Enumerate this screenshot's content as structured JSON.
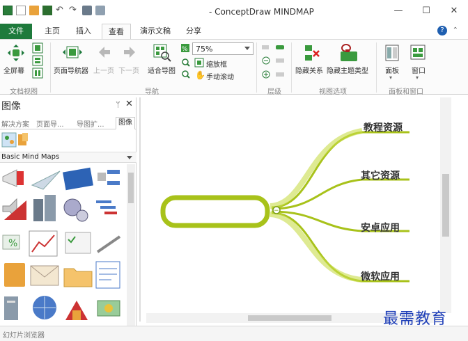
{
  "window": {
    "title": "- ConceptDraw MINDMAP",
    "controls": {
      "minimize": "—",
      "maximize": "☐",
      "close": "✕"
    }
  },
  "tabs": [
    {
      "label": "文件"
    },
    {
      "label": "主页"
    },
    {
      "label": "插入"
    },
    {
      "label": "查看"
    },
    {
      "label": "演示文稿"
    },
    {
      "label": "分享"
    }
  ],
  "active_tab": "查看",
  "help_label": "?",
  "ribbon": {
    "fullscreen": "全屏幕",
    "page_navigator": "页面导航器",
    "prev_page": "上一页",
    "next_page": "下一页",
    "fit_map": "适合导图",
    "zoom_value": "75%",
    "zoom_frame": "缩放框",
    "hand_scroll": "手动滚动",
    "hide_relations": "隐藏关系",
    "hide_topic_types": "隐藏主题类型",
    "panels": "面板",
    "window": "窗口",
    "groups": {
      "doc_view": "文档视图",
      "navigation": "导航",
      "levels": "层级",
      "view_options": "视图选项",
      "panels_windows": "面板和窗口"
    }
  },
  "left_panel": {
    "title": "图像",
    "pin": "ᛘ",
    "close": "✕",
    "tabs": [
      {
        "label": "解决方案"
      },
      {
        "label": "页面导..."
      },
      {
        "label": "导图扩..."
      },
      {
        "label": "图像"
      }
    ],
    "library": "Basic Mind Maps"
  },
  "canvas": {
    "topics": [
      {
        "label": "教程资源"
      },
      {
        "label": "其它资源"
      },
      {
        "label": "安卓应用"
      },
      {
        "label": "微软应用"
      }
    ],
    "collapse_symbol": "−"
  },
  "status_bar": {
    "text": "幻灯片浏览器"
  },
  "watermark": "最需教育",
  "colors": {
    "file_tab": "#1e7a3c",
    "branch": "#a8c21a",
    "branch_dark": "#7a9e16",
    "watermark": "#1f3fb8"
  }
}
